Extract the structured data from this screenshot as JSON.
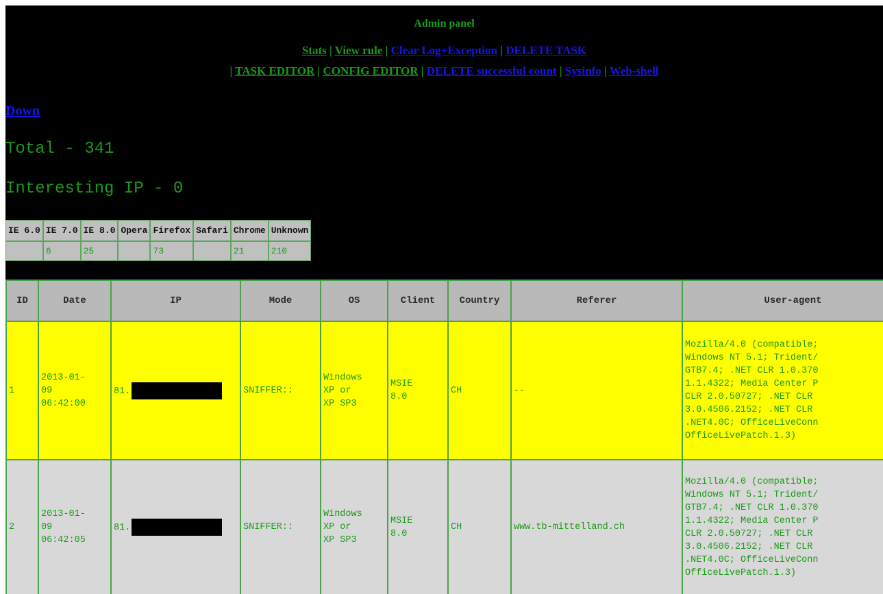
{
  "header": {
    "title": "Admin panel",
    "nav_row1": [
      {
        "label": "Stats",
        "color": "green"
      },
      {
        "label": "View rule",
        "color": "green"
      },
      {
        "label": "Clear Log+Exception",
        "color": "blue"
      },
      {
        "label": "DELETE TASK",
        "color": "blue"
      }
    ],
    "nav_row2": [
      {
        "label": "TASK EDITOR",
        "color": "green"
      },
      {
        "label": "CONFIG EDITOR",
        "color": "green"
      },
      {
        "label": "DELETE successful count",
        "color": "blue"
      },
      {
        "label": "Sysinfo",
        "color": "blue"
      },
      {
        "label": "Web-shell",
        "color": "blue"
      }
    ],
    "separator": "|"
  },
  "down_link": "Down",
  "total": "Total - 341",
  "interesting": "Interesting IP - 0",
  "browsers": {
    "headers": [
      "IE 6.0",
      "IE 7.0",
      "IE 8.0",
      "Opera",
      "Firefox",
      "Safari",
      "Chrome",
      "Unknown"
    ],
    "values": [
      "",
      "6",
      "25",
      "",
      "73",
      "",
      "21",
      "210"
    ]
  },
  "log": {
    "headers": [
      "ID",
      "Date",
      "IP",
      "Mode",
      "OS",
      "Client",
      "Country",
      "Referer",
      "User-agent"
    ],
    "rows": [
      {
        "id": "1",
        "date": [
          "2013-01-",
          "09",
          "06:42:00"
        ],
        "ip_prefix": "81.",
        "mode": "SNIFFER::",
        "os": [
          "Windows",
          "XP or",
          "XP SP3"
        ],
        "client": [
          "MSIE",
          "8.0"
        ],
        "country": "CH",
        "referer": "--",
        "user_agent": [
          "Mozilla/4.0 (compatible;",
          "Windows NT 5.1; Trident/",
          "GTB7.4; .NET CLR 1.0.370",
          "1.1.4322; Media Center P",
          "CLR 2.0.50727; .NET CLR",
          "3.0.4506.2152; .NET CLR",
          ".NET4.0C; OfficeLiveConn",
          "OfficeLivePatch.1.3)"
        ]
      },
      {
        "id": "2",
        "date": [
          "2013-01-",
          "09",
          "06:42:05"
        ],
        "ip_prefix": "81.",
        "mode": "SNIFFER::",
        "os": [
          "Windows",
          "XP or",
          "XP SP3"
        ],
        "client": [
          "MSIE",
          "8.0"
        ],
        "country": "CH",
        "referer": "www.tb-mittelland.ch",
        "user_agent": [
          "Mozilla/4.0 (compatible;",
          "Windows NT 5.1; Trident/",
          "GTB7.4; .NET CLR 1.0.370",
          "1.1.4322; Media Center P",
          "CLR 2.0.50727; .NET CLR",
          "3.0.4506.2152; .NET CLR",
          ".NET4.0C; OfficeLiveConn",
          "OfficeLivePatch.1.3)"
        ]
      }
    ]
  },
  "colors": {
    "background": "#000000",
    "text_green": "#1a9a1a",
    "link_blue": "#1515e6",
    "highlight_row": "#ffff00",
    "normal_row": "#d8d8d8",
    "header_cell": "#b9b9b9"
  }
}
